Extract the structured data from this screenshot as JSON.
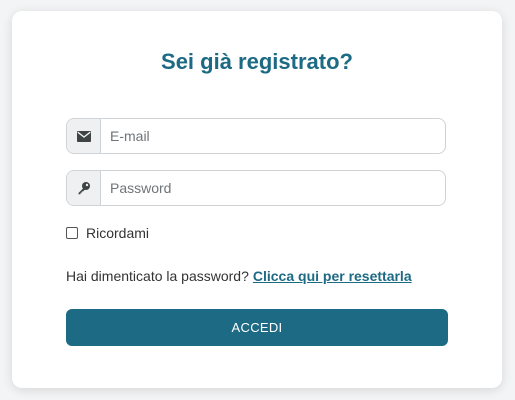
{
  "login": {
    "title": "Sei già registrato?",
    "email": {
      "placeholder": "E-mail",
      "value": "",
      "icon": "envelope-icon"
    },
    "password": {
      "placeholder": "Password",
      "value": "",
      "icon": "key-icon"
    },
    "remember_label": "Ricordami",
    "remember_checked": false,
    "forgot_text": "Hai dimenticato la password?",
    "forgot_link": "Clicca qui per resettarla",
    "submit_label": "ACCEDI"
  },
  "colors": {
    "accent": "#1d6a84",
    "field_border": "#cfd3d6",
    "addon_bg": "#eef0f2"
  }
}
